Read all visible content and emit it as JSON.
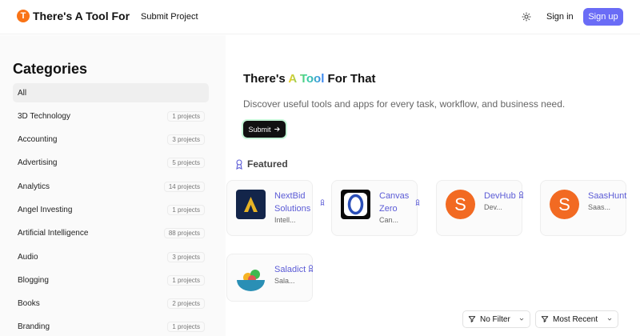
{
  "header": {
    "logo_letter": "T",
    "logo_text": "There's A Tool For",
    "submit_project": "Submit Project",
    "sign_in": "Sign in",
    "sign_up": "Sign up",
    "theme_icon": "sun-icon",
    "brand_color": "#6a6cf6"
  },
  "sidebar": {
    "title": "Categories",
    "items": [
      {
        "label": "All",
        "count": ""
      },
      {
        "label": "3D Technology",
        "count": "1 projects"
      },
      {
        "label": "Accounting",
        "count": "3 projects"
      },
      {
        "label": "Advertising",
        "count": "5 projects"
      },
      {
        "label": "Analytics",
        "count": "14 projects"
      },
      {
        "label": "Angel Investing",
        "count": "1 projects"
      },
      {
        "label": "Artificial Intelligence",
        "count": "88 projects"
      },
      {
        "label": "Audio",
        "count": "3 projects"
      },
      {
        "label": "Blogging",
        "count": "1 projects"
      },
      {
        "label": "Books",
        "count": "2 projects"
      },
      {
        "label": "Branding",
        "count": "1 projects"
      }
    ]
  },
  "hero": {
    "title_before": "There's ",
    "title_highlight": "A Tool",
    "title_after": " For That",
    "subtitle": "Discover useful tools and apps for every task, workflow, and business need.",
    "submit": "Submit"
  },
  "featured": {
    "label": "Featured",
    "cards": [
      {
        "name": "NextBid Solutions",
        "desc": "Intell...",
        "icon": "nextbid-logo"
      },
      {
        "name": "Canvas Zero",
        "desc": "Can...",
        "icon": "canvas-zero-logo"
      },
      {
        "name": "DevHub",
        "desc": "Dev...",
        "icon": "devhub-logo"
      },
      {
        "name": "SaasHunt",
        "desc": "Saas...",
        "icon": "saashunt-logo"
      },
      {
        "name": "Saladict",
        "desc": "Sala...",
        "icon": "saladict-logo"
      }
    ]
  },
  "filters": {
    "filter_label": "No Filter",
    "sort_label": "Most Recent"
  }
}
